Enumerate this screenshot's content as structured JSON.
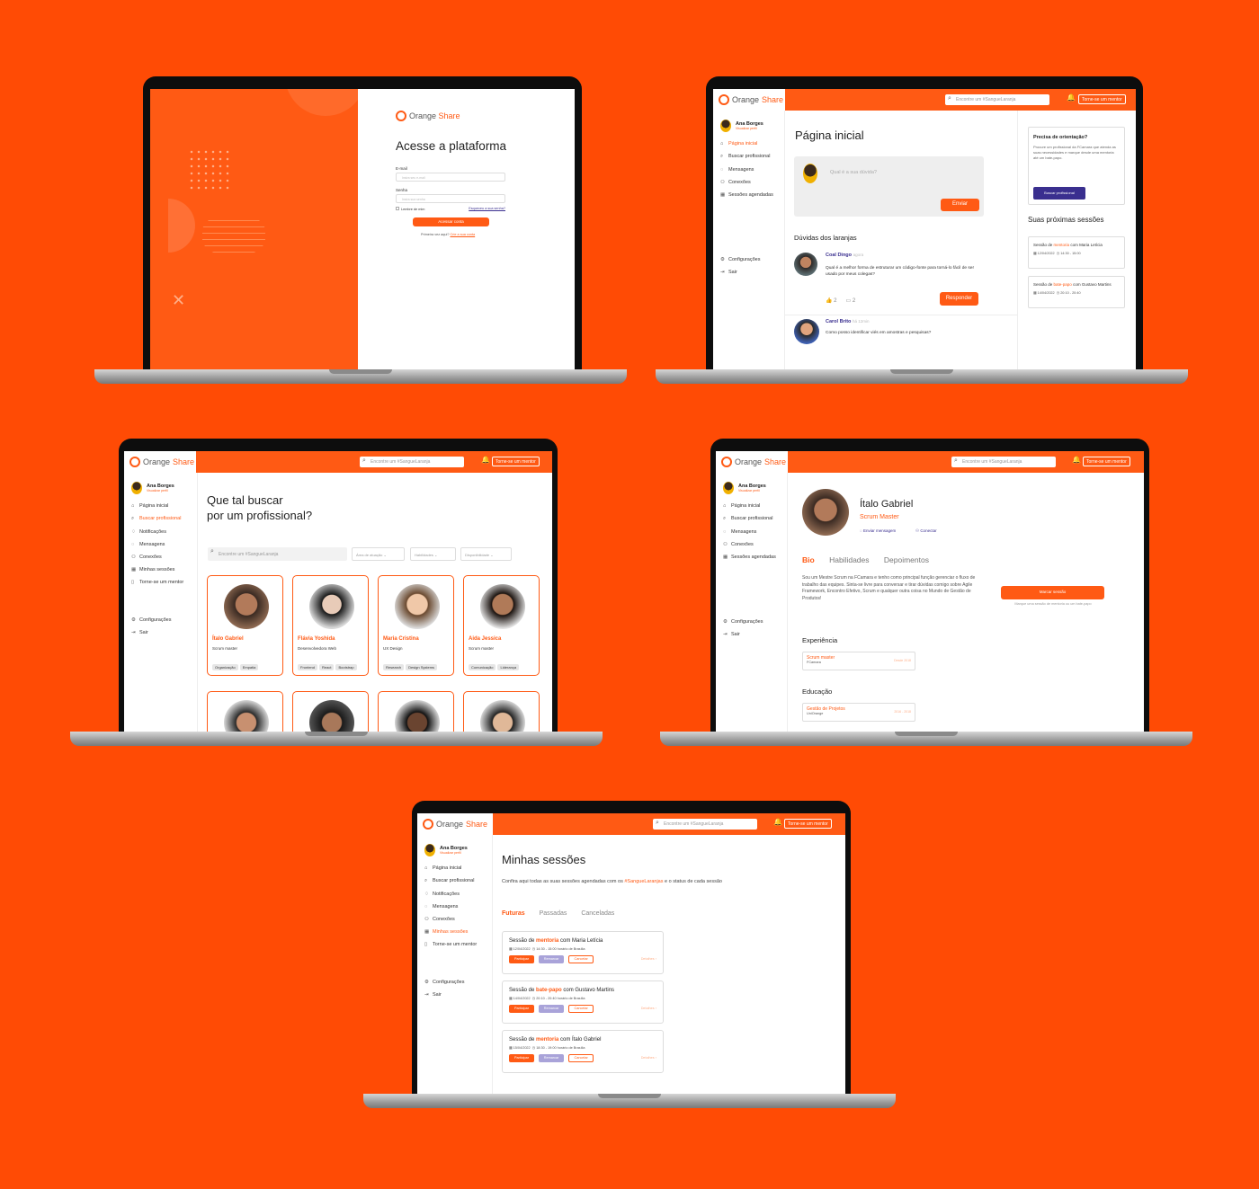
{
  "brand": {
    "orange_word": "Orange",
    "share_word": "Share",
    "accent": "#ff5a14",
    "background": "#ff4b05",
    "purple": "#3a2f8f"
  },
  "login": {
    "title": "Acesse a plataforma",
    "email_label": "E-mail",
    "email_placeholder": "Insira seu e-mail",
    "password_label": "Senha",
    "password_placeholder": "Insira sua senha",
    "remember": "Lembre de mim",
    "forgot": "Esqueceu a sua senha?",
    "submit": "Acessar conta",
    "first_time": "Primeira vez aqui?",
    "create": "Crie a sua conta"
  },
  "chrome": {
    "search_placeholder": "Encontre um #SangueLaranja",
    "mentor_button": "Torne-se um mentor",
    "user_name": "Ana Borges",
    "user_sub": "Visualizar perfil"
  },
  "nav_home": [
    "Página inicial",
    "Buscar profissional",
    "Mensagens",
    "Conexões",
    "Sessões agendadas"
  ],
  "nav_search": [
    "Página inicial",
    "Buscar profissional",
    "Notificações",
    "Mensagens",
    "Conexões",
    "Minhas sessões",
    "Torne-se um mentor"
  ],
  "nav_profile": [
    "Página inicial",
    "Buscar profissional",
    "Mensagens",
    "Conexões",
    "Sessões agendadas"
  ],
  "nav_sessions": [
    "Página inicial",
    "Buscar profissional",
    "Notificações",
    "Mensagens",
    "Conexões",
    "Minhas sessões",
    "Torne-se um mentor"
  ],
  "nav_bottom": {
    "settings": "Configurações",
    "logout": "Sair"
  },
  "home": {
    "title": "Página inicial",
    "question_placeholder": "Qual é a sua dúvida?",
    "send": "Enviar",
    "section": "Dúvidas dos laranjas",
    "posts": [
      {
        "author": "Coal Dingo",
        "time": "agora",
        "text": "Qual é a melhor forma de estruturar um código-fonte para torná-lo fácil de ser usado por meus colegas?",
        "likes": "2",
        "comments": "2",
        "reply": "Responder"
      },
      {
        "author": "Carol Brito",
        "time": "há 12min",
        "text": "Como posso identificar viés em amostras e pesquisas?"
      }
    ],
    "help_title": "Precisa de orientação?",
    "help_text": "Procure um profissional da FCamara que atenda as suas necessidades e marque desde uma mentoria até um bate-papo.",
    "help_button": "Buscar profissional",
    "next_title": "Suas próximas sessões",
    "next": [
      {
        "prefix": "Sessão de",
        "kind": "mentoria",
        "with": "com Maria Letícia",
        "date": "12/04/2022",
        "time": "14:30 - 15:00"
      },
      {
        "prefix": "Sessão de",
        "kind": "bate-papo",
        "with": "com Gustavo Martins",
        "date": "14/04/2022",
        "time": "20:10 - 20:40"
      }
    ]
  },
  "search": {
    "title_line1": "Que tal buscar",
    "title_line2": "por um profissional?",
    "filters": [
      "Área de atuação",
      "Habilidades",
      "Disponibilidade"
    ],
    "people": [
      {
        "name": "Ítalo Gabriel",
        "role": "Scrum master",
        "tags": [
          "Organização",
          "Empatia"
        ]
      },
      {
        "name": "Flávia Yoshida",
        "role": "Desenvolvedora Web",
        "tags": [
          "Frontend",
          "React",
          "Bootstrap"
        ]
      },
      {
        "name": "Maria Cristina",
        "role": "UX Design",
        "tags": [
          "Research",
          "Design Systems"
        ]
      },
      {
        "name": "Aida Jessica",
        "role": "Scrum master",
        "tags": [
          "Comunicação",
          "Liderança"
        ]
      }
    ]
  },
  "profile": {
    "name": "Ítalo Gabriel",
    "role": "Scrum Master",
    "send_message": "Enviar mensagem",
    "connect": "Conectar",
    "tabs": [
      "Bio",
      "Habilidades",
      "Depoimentos"
    ],
    "bio": "Sou um Mestre Scrum na FCamara e tenho como principal função gerenciar o fluxo de trabalho das equipes. Sinta-se livre para conversar e tirar dúvidas comigo sobre Agile Framework, Encontro Efetivo, Scrum e qualquer outra coisa no Mundo de Gestão de Produtos!",
    "schedule": "Marcar sessão",
    "schedule_hint": "Marque uma sessão de mentoria ou um bate-papo",
    "experience_title": "Experiência",
    "experience": {
      "role": "Scrum master",
      "company": "FCamara",
      "period": "Desde 2018"
    },
    "education_title": "Educação",
    "education": {
      "course": "Gestão de Projetos",
      "school": "UniOrange",
      "period": "2016 - 2018"
    }
  },
  "sessions": {
    "title": "Minhas sessões",
    "intro": "Confira aqui todas as suas sessões agendadas com os",
    "hashtag": "#SangueLaranjas",
    "intro2": "e o status de cada sessão",
    "tabs": [
      "Futuras",
      "Passadas",
      "Canceladas"
    ],
    "items": [
      {
        "prefix": "Sessão de",
        "kind": "mentoria",
        "with": "com Maria Letícia",
        "date": "12/04/2022",
        "time": "14:30 - 15:00 horário de Brasília"
      },
      {
        "prefix": "Sessão de",
        "kind": "bate-papo",
        "with": "com Gustavo Martins",
        "date": "14/04/2022",
        "time": "20:10 - 20:40 horário de Brasília"
      },
      {
        "prefix": "Sessão de",
        "kind": "mentoria",
        "with": "com Ítalo Gabriel",
        "date": "15/04/2022",
        "time": "18:30 - 19:00 horário de Brasília"
      }
    ],
    "actions": [
      "Participar",
      "Remarcar",
      "Cancelar"
    ],
    "details": "Detalhes ›"
  }
}
